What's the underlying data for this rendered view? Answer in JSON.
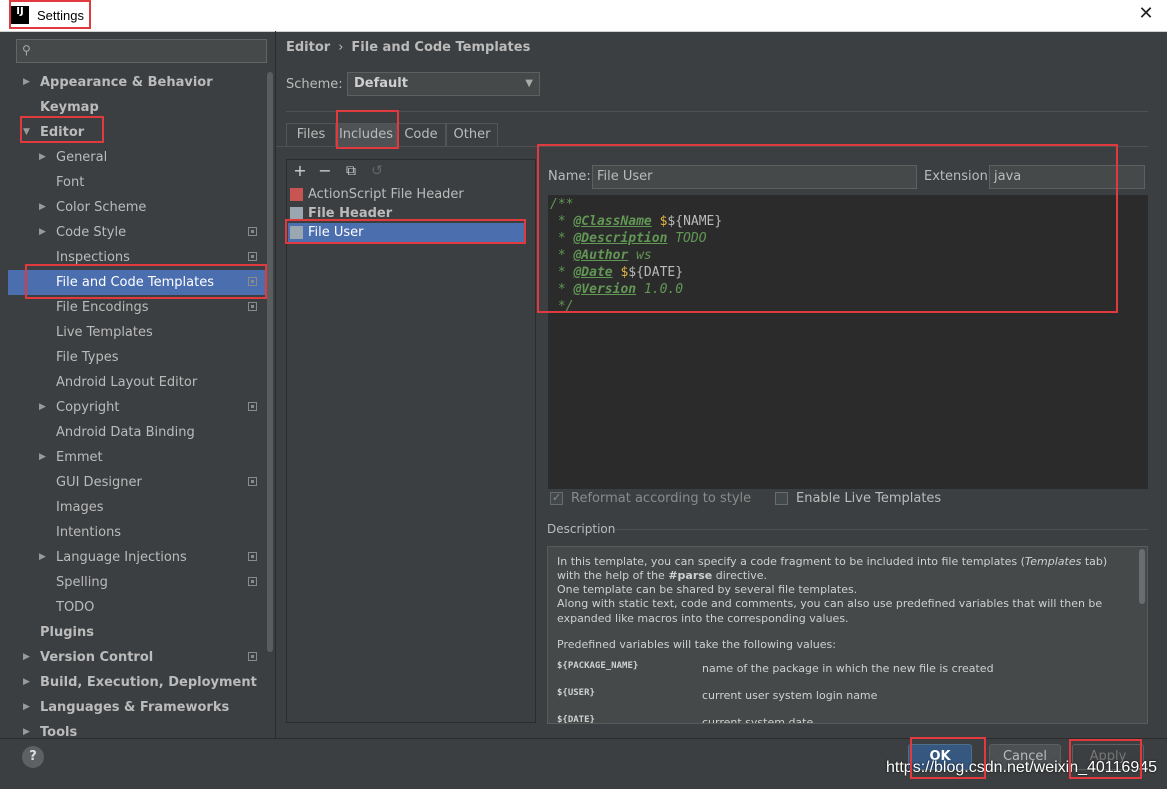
{
  "window": {
    "title": "Settings"
  },
  "search": {
    "placeholder": ""
  },
  "sidebar": {
    "items": [
      {
        "label": "Appearance & Behavior"
      },
      {
        "label": "Keymap"
      },
      {
        "label": "Editor"
      },
      {
        "label": "General"
      },
      {
        "label": "Font"
      },
      {
        "label": "Color Scheme"
      },
      {
        "label": "Code Style"
      },
      {
        "label": "Inspections"
      },
      {
        "label": "File and Code Templates"
      },
      {
        "label": "File Encodings"
      },
      {
        "label": "Live Templates"
      },
      {
        "label": "File Types"
      },
      {
        "label": "Android Layout Editor"
      },
      {
        "label": "Copyright"
      },
      {
        "label": "Android Data Binding"
      },
      {
        "label": "Emmet"
      },
      {
        "label": "GUI Designer"
      },
      {
        "label": "Images"
      },
      {
        "label": "Intentions"
      },
      {
        "label": "Language Injections"
      },
      {
        "label": "Spelling"
      },
      {
        "label": "TODO"
      },
      {
        "label": "Plugins"
      },
      {
        "label": "Version Control"
      },
      {
        "label": "Build, Execution, Deployment"
      },
      {
        "label": "Languages & Frameworks"
      },
      {
        "label": "Tools"
      }
    ]
  },
  "breadcrumb": {
    "parent": "Editor",
    "separator": "›",
    "current": "File and Code Templates"
  },
  "scheme": {
    "label": "Scheme:",
    "value": "Default"
  },
  "tabs": [
    {
      "label": "Files"
    },
    {
      "label": "Includes"
    },
    {
      "label": "Code"
    },
    {
      "label": "Other"
    }
  ],
  "toolbar": {
    "add": "+",
    "remove": "−",
    "copy": "⧉",
    "reset": "↺"
  },
  "templates": [
    {
      "name": "ActionScript File Header"
    },
    {
      "name": "File Header"
    },
    {
      "name": "File User"
    }
  ],
  "form": {
    "name_label": "Name:",
    "name_value": "File User",
    "ext_label": "Extension:",
    "ext_value": "java"
  },
  "code": {
    "l1": "/**",
    "classname_tag": "@ClassName",
    "classname_var": "${NAME}",
    "description_tag": "@Description",
    "description_val": "TODO",
    "author_tag": "@Author",
    "author_val": "ws",
    "date_tag": "@Date",
    "date_var": "${DATE}",
    "version_tag": "@Version",
    "version_val": "1.0.0",
    "close": "*/"
  },
  "options": {
    "reformat": "Reformat according to style",
    "live": "Enable Live Templates"
  },
  "description": {
    "title": "Description",
    "p1a": "In this template, you can specify a code fragment to be included into file templates (",
    "p1b": "Templates",
    "p1c": " tab)",
    "p2a": "with the help of the ",
    "p2b": "#parse",
    "p2c": " directive.",
    "p3": "One template can be shared by several file templates.",
    "p4": "Along with static text, code and comments, you can also use predefined variables that will then be",
    "p5": "expanded like macros into the corresponding values.",
    "p6": "Predefined variables will take the following values:",
    "vars": [
      {
        "name": "${PACKAGE_NAME}",
        "desc": "name of the package in which the new file is created"
      },
      {
        "name": "${USER}",
        "desc": "current user system login name"
      },
      {
        "name": "${DATE}",
        "desc": "current system date"
      }
    ]
  },
  "buttons": {
    "ok": "OK",
    "cancel": "Cancel",
    "apply": "Apply",
    "help": "?"
  },
  "watermark": "https://blog.csdn.net/weixin_40116945"
}
